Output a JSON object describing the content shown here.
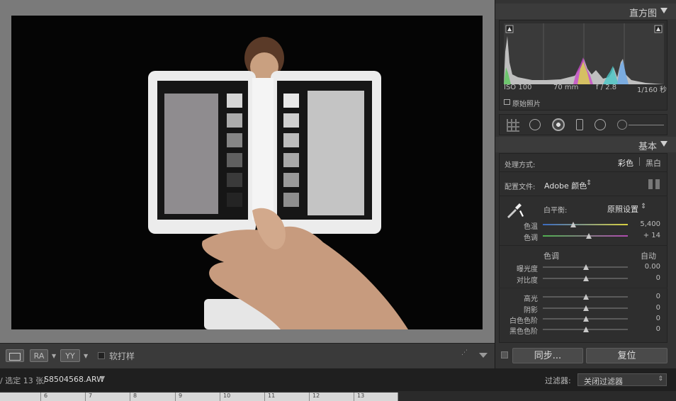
{
  "histogram": {
    "title": "直方图",
    "iso": "ISO 100",
    "focal": "70 mm",
    "aperture": "f / 2.8",
    "shutter": "1/160 秒",
    "original_photo": "原始照片"
  },
  "basic": {
    "title": "基本",
    "treatment_label": "处理方式:",
    "treatment_color": "彩色",
    "treatment_bw": "黑白",
    "profile_label": "配置文件:",
    "profile_value": "Adobe 颜色",
    "wb_label": "白平衡:",
    "wb_value": "原照设置",
    "temp_label": "色温",
    "temp_value": "5,400",
    "tint_label": "色调",
    "tint_value": "+ 14",
    "tone_title": "色调",
    "auto": "自动",
    "exposure_label": "曝光度",
    "exposure_value": "0.00",
    "contrast_label": "对比度",
    "contrast_value": "0",
    "highlights_label": "高光",
    "highlights_value": "0",
    "shadows_label": "阴影",
    "shadows_value": "0",
    "whites_label": "白色色阶",
    "whites_value": "0",
    "blacks_label": "黑色色阶",
    "blacks_value": "0"
  },
  "buttons": {
    "sync": "同步...",
    "reset": "复位"
  },
  "toolbar": {
    "soft_proof": "软打样",
    "ra": "RA",
    "yy": "YY"
  },
  "status": {
    "selection": "/ 选定 13 张/",
    "filename": "S8504568.ARW",
    "filter_label": "过滤器:",
    "filter_value": "关闭过滤器"
  },
  "filmstrip": [
    "6",
    "7",
    "8",
    "9",
    "10",
    "11",
    "12",
    "13"
  ]
}
